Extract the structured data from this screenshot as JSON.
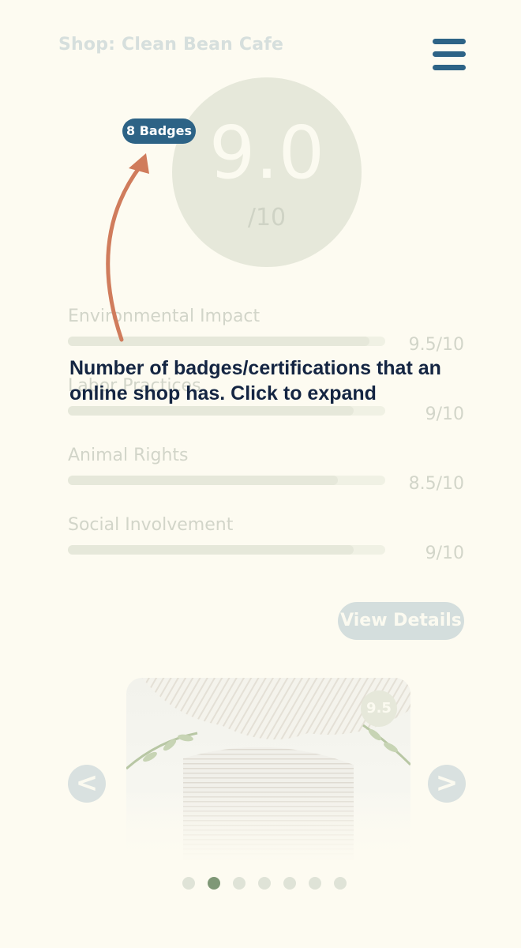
{
  "header": {
    "shop_title": "Shop: Clean Bean Cafe"
  },
  "score": {
    "value": "9.0",
    "max": "/10"
  },
  "badges": {
    "label": "8 Badges"
  },
  "metrics": [
    {
      "label": "Environmental Impact",
      "score": "9.5/10",
      "value": 9.5
    },
    {
      "label": "Labor Practices",
      "score": "9/10",
      "value": 9
    },
    {
      "label": "Animal Rights",
      "score": "8.5/10",
      "value": 8.5
    },
    {
      "label": "Social Involvement",
      "score": "9/10",
      "value": 9
    }
  ],
  "details_button": {
    "label": "View Details"
  },
  "carousel": {
    "card_score": "9.5",
    "prev_label": "<",
    "next_label": ">",
    "page_count": 7,
    "active_index": 1
  },
  "annotation": {
    "text": "Number of badges/certifications that an online shop has. Click to expand"
  },
  "colors": {
    "accent": "#2d6386",
    "annotation_arrow": "#d07c5c",
    "annotation_text": "#142542",
    "active_dot": "#7f9877"
  }
}
